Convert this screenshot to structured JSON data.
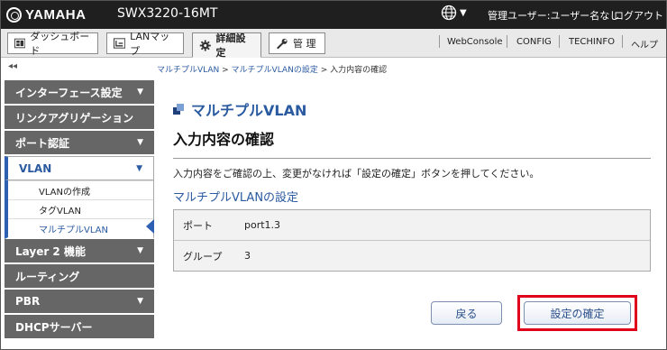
{
  "header": {
    "brand": "YAMAHA",
    "model": "SWX3220-16MT",
    "admin_label": "管理ユーザー:ユーザー名なし",
    "logout_label": "ログアウト"
  },
  "nav": {
    "tabs": [
      {
        "label": "ダッシュボード",
        "icon": "dashboard-icon"
      },
      {
        "label": "LANマップ",
        "icon": "lan-map-icon"
      },
      {
        "label": "詳細設定",
        "icon": "gear-icon"
      },
      {
        "label": "管 理",
        "icon": "wrench-icon"
      }
    ],
    "links": [
      "WebConsole",
      "CONFIG",
      "TECHINFO",
      "ヘルプ"
    ]
  },
  "sidebar": {
    "collapse": "◂◂",
    "items": [
      {
        "label": "インターフェース設定",
        "arrow": "▼"
      },
      {
        "label": "リンクアグリゲーション",
        "arrow": ""
      },
      {
        "label": "ポート認証",
        "arrow": "▼"
      },
      {
        "label": "VLAN",
        "arrow": "▼"
      },
      {
        "label": "Layer 2 機能",
        "arrow": "▼"
      },
      {
        "label": "ルーティング",
        "arrow": ""
      },
      {
        "label": "PBR",
        "arrow": "▼"
      },
      {
        "label": "DHCPサーバー",
        "arrow": ""
      }
    ],
    "vlan_sub": [
      "VLANの作成",
      "タグVLAN",
      "マルチプルVLAN"
    ]
  },
  "main": {
    "breadcrumb": [
      "マルチプルVLAN",
      "マルチプルVLANの設定",
      "入力内容の確認"
    ],
    "breadcrumb_sep": " > ",
    "page_title": "マルチプルVLAN",
    "sub_title": "入力内容の確認",
    "note": "入力内容をご確認の上、変更がなければ「設定の確定」ボタンを押してください。",
    "section_title": "マルチプルVLANの設定",
    "rows": [
      {
        "key": "ポート",
        "value": "port1.3"
      },
      {
        "key": "グループ",
        "value": "3"
      }
    ],
    "back_button": "戻る",
    "confirm_button": "設定の確定"
  },
  "colors": {
    "accent": "#2a5aa0",
    "highlight": "#e0001b",
    "header_bg": "#1f1f1f",
    "sidebar_item_bg": "#666666"
  }
}
